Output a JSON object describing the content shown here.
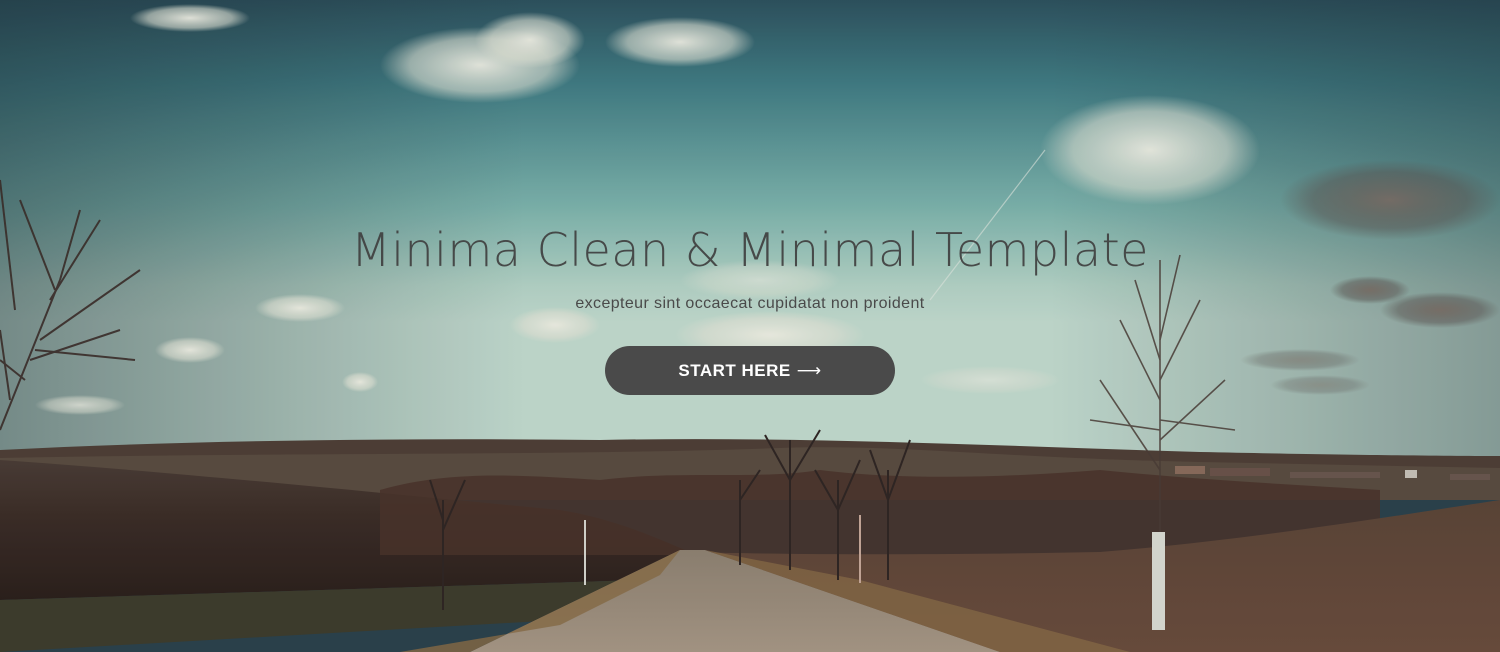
{
  "hero": {
    "title": "Minima Clean & Minimal Template",
    "subtitle": "excepteur sint occaecat cupidatat non proident",
    "cta_label": "START HERE",
    "cta_arrow": "⟶"
  },
  "colors": {
    "sky_top": "#2f5a66",
    "sky_mid": "#7fb4ad",
    "sky_horizon": "#c9ddd0",
    "field_dark": "#3a2a24",
    "field_brown": "#5a3e30",
    "road": "#9a8a78",
    "button_bg": "#4a4a4a",
    "title_text": "#404040"
  }
}
